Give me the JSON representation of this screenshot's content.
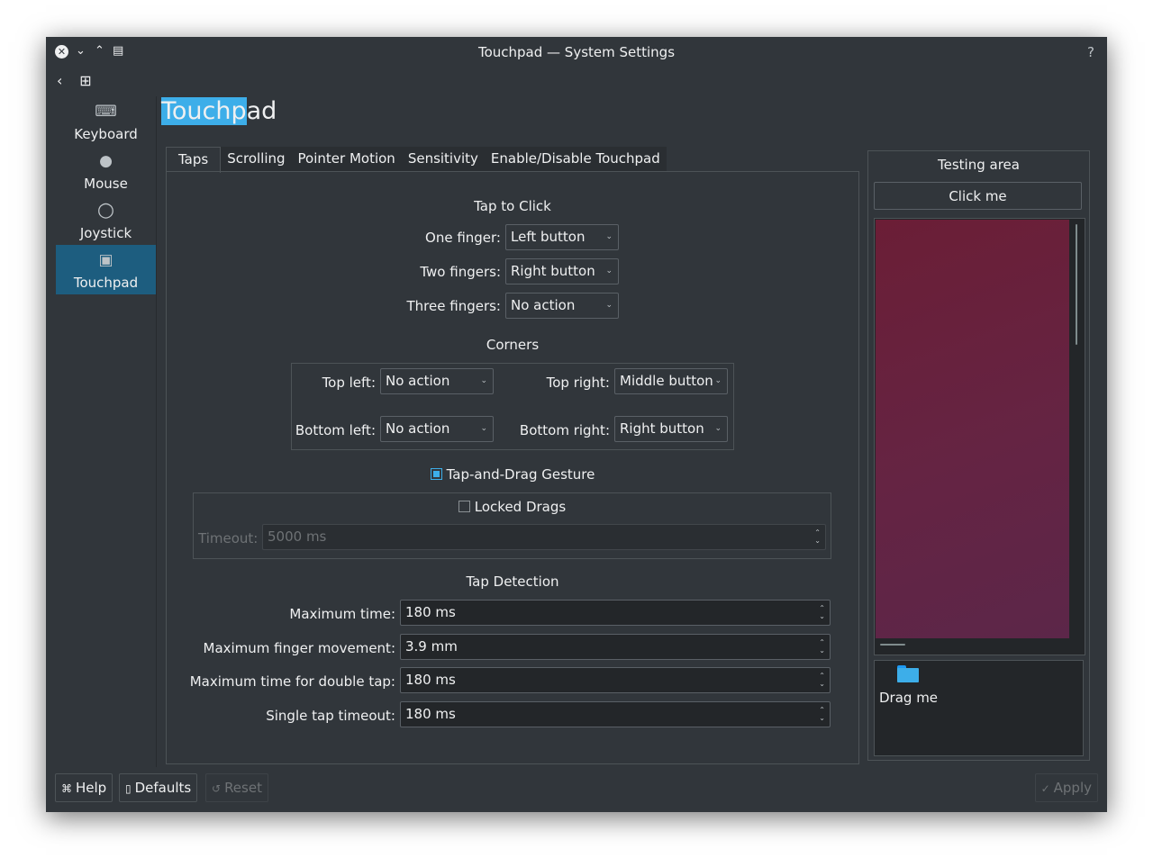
{
  "window": {
    "title": "Touchpad — System Settings",
    "help": "?"
  },
  "sidebar": {
    "items": [
      {
        "label": "Keyboard",
        "icon": "keyboard-icon"
      },
      {
        "label": "Mouse",
        "icon": "mouse-icon"
      },
      {
        "label": "Joystick",
        "icon": "joystick-icon"
      },
      {
        "label": "Touchpad",
        "icon": "touchpad-icon",
        "active": true
      }
    ]
  },
  "page": {
    "title_highlight": "Touchp",
    "title_rest": "ad"
  },
  "tabs": [
    "Taps",
    "Scrolling",
    "Pointer Motion",
    "Sensitivity",
    "Enable/Disable Touchpad"
  ],
  "tap_to_click": {
    "heading": "Tap to Click",
    "one_finger": {
      "label": "One finger:",
      "value": "Left button"
    },
    "two_fingers": {
      "label": "Two fingers:",
      "value": "Right button"
    },
    "three_fingers": {
      "label": "Three fingers:",
      "value": "No action"
    }
  },
  "corners": {
    "heading": "Corners",
    "top_left": {
      "label": "Top left:",
      "value": "No action"
    },
    "top_right": {
      "label": "Top right:",
      "value": "Middle button"
    },
    "bottom_left": {
      "label": "Bottom left:",
      "value": "No action"
    },
    "bottom_right": {
      "label": "Bottom right:",
      "value": "Right button"
    }
  },
  "tap_drag": {
    "label": "Tap-and-Drag Gesture",
    "checked": true
  },
  "locked_drags": {
    "label": "Locked Drags",
    "checked": false
  },
  "timeout": {
    "label": "Timeout:",
    "value": "5000 ms"
  },
  "tap_detection": {
    "heading": "Tap Detection",
    "max_time": {
      "label": "Maximum time:",
      "value": "180 ms"
    },
    "max_movement": {
      "label": "Maximum finger movement:",
      "value": "3.9 mm"
    },
    "double_tap": {
      "label": "Maximum time for double tap:",
      "value": "180 ms"
    },
    "single_tap": {
      "label": "Single tap timeout:",
      "value": "180 ms"
    }
  },
  "testing": {
    "title": "Testing area",
    "click_button": "Click me",
    "drag_label": "Drag me"
  },
  "buttons": {
    "help": "Help",
    "defaults": "Defaults",
    "reset": "Reset",
    "apply": "Apply"
  },
  "colors": {
    "accent": "#3daee9",
    "background": "#31363b",
    "selection": "#1d5d7f"
  }
}
